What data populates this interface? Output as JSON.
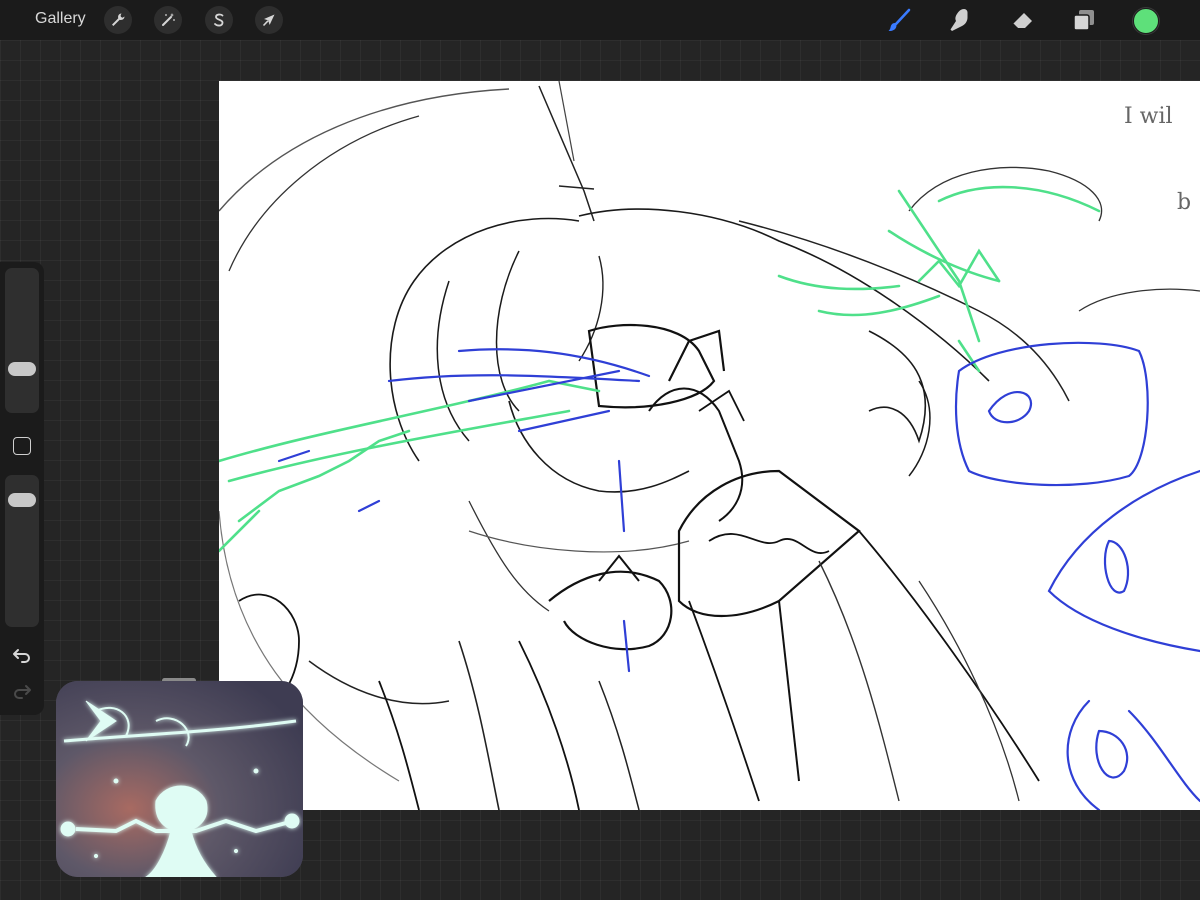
{
  "topbar": {
    "gallery_label": "Gallery",
    "left_tools": [
      {
        "name": "actions",
        "icon": "wrench-icon"
      },
      {
        "name": "adjustments",
        "icon": "magic-wand-icon"
      },
      {
        "name": "selection",
        "icon": "selection-s-icon"
      },
      {
        "name": "transform",
        "icon": "arrow-cursor-icon"
      }
    ],
    "right_tools": [
      {
        "name": "brush",
        "icon": "brush-icon",
        "active": true
      },
      {
        "name": "smudge",
        "icon": "smudge-finger-icon",
        "active": false
      },
      {
        "name": "eraser",
        "icon": "eraser-icon",
        "active": false
      },
      {
        "name": "layers",
        "icon": "layers-icon",
        "active": false
      }
    ],
    "current_color": "#5ee07a",
    "active_tool_color": "#3a7bff"
  },
  "sidebar": {
    "brush_size_level": 0.35,
    "opacity_level": 0.97,
    "modify_icon": "square-modify-icon",
    "undo_icon": "undo-icon",
    "redo_icon": "redo-icon"
  },
  "canvas": {
    "background": "#ffffff",
    "stroke_colors": {
      "sketch": "#1a1a1a",
      "green": "#4fe08a",
      "blue": "#2f3fd6"
    },
    "handwritten_notes": [
      "I wil",
      "b"
    ]
  },
  "reference_window": {
    "icon": "reference-image-icon"
  }
}
